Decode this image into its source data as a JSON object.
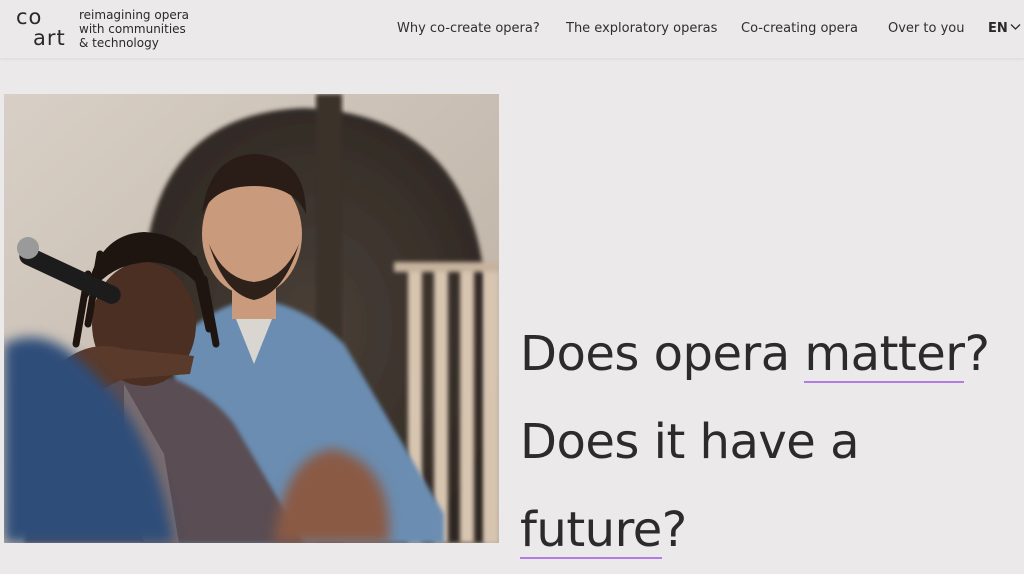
{
  "brand": {
    "logo_line1": "co",
    "logo_line2": "art",
    "tagline": [
      "reimagining opera",
      "with communities",
      "& technology"
    ]
  },
  "nav": {
    "items": [
      "Why co-create opera?",
      "The exploratory operas",
      "Co-creating opera",
      "Over to you"
    ],
    "language": "EN"
  },
  "hero": {
    "headline_line1_pre": "Does opera ",
    "headline_line1_highlight": "matter",
    "headline_line1_post": "?",
    "headline_line2": "Does it have a",
    "headline_line3_highlight": "future",
    "headline_line3_post": "?"
  },
  "colors": {
    "background": "#ebe9ea",
    "text": "#2a2a2a",
    "underline_accent": "#b27ce6"
  }
}
